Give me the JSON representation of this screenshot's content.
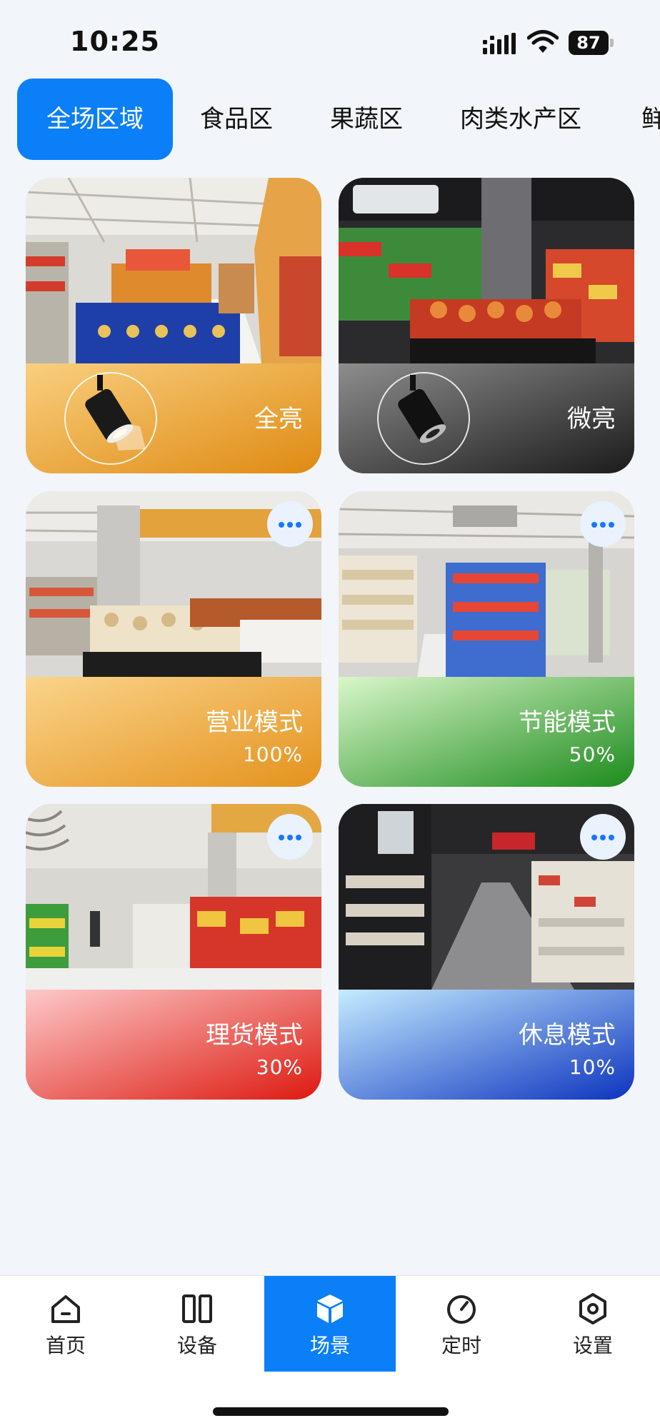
{
  "status_bar": {
    "time": "10:25",
    "battery": "87"
  },
  "tabs": [
    {
      "label": "全场区域",
      "active": true
    },
    {
      "label": "食品区",
      "active": false
    },
    {
      "label": "果蔬区",
      "active": false
    },
    {
      "label": "肉类水产区",
      "active": false
    },
    {
      "label": "鲜",
      "active": false
    }
  ],
  "scenes": [
    {
      "name": "全亮",
      "percent": null,
      "icon": "spotlight-icon",
      "colors": [
        "#f9cf7f",
        "#df8a12"
      ]
    },
    {
      "name": "微亮",
      "percent": null,
      "icon": "spotlight-icon",
      "colors": [
        "#8d8d8d",
        "#1b1b1b"
      ]
    },
    {
      "name": "营业模式",
      "percent": "100%",
      "icon": "more-icon",
      "colors": [
        "#fad48b",
        "#e4921c"
      ]
    },
    {
      "name": "节能模式",
      "percent": "50%",
      "icon": "more-icon",
      "colors": [
        "#d9f7c9",
        "#1c8b1c"
      ]
    },
    {
      "name": "理货模式",
      "percent": "30%",
      "icon": "more-icon",
      "colors": [
        "#fdc9c9",
        "#dd1a10"
      ]
    },
    {
      "name": "休息模式",
      "percent": "10%",
      "icon": "more-icon",
      "colors": [
        "#c4ecff",
        "#0d34bf"
      ]
    }
  ],
  "bottom_nav": [
    {
      "label": "首页",
      "icon": "home-icon",
      "active": false
    },
    {
      "label": "设备",
      "icon": "devices-icon",
      "active": false
    },
    {
      "label": "场景",
      "icon": "scene-cube-icon",
      "active": true
    },
    {
      "label": "定时",
      "icon": "timer-icon",
      "active": false
    },
    {
      "label": "设置",
      "icon": "settings-hex-icon",
      "active": false
    }
  ],
  "colors": {
    "accent": "#0a7ff7",
    "background": "#f2f5f9"
  }
}
